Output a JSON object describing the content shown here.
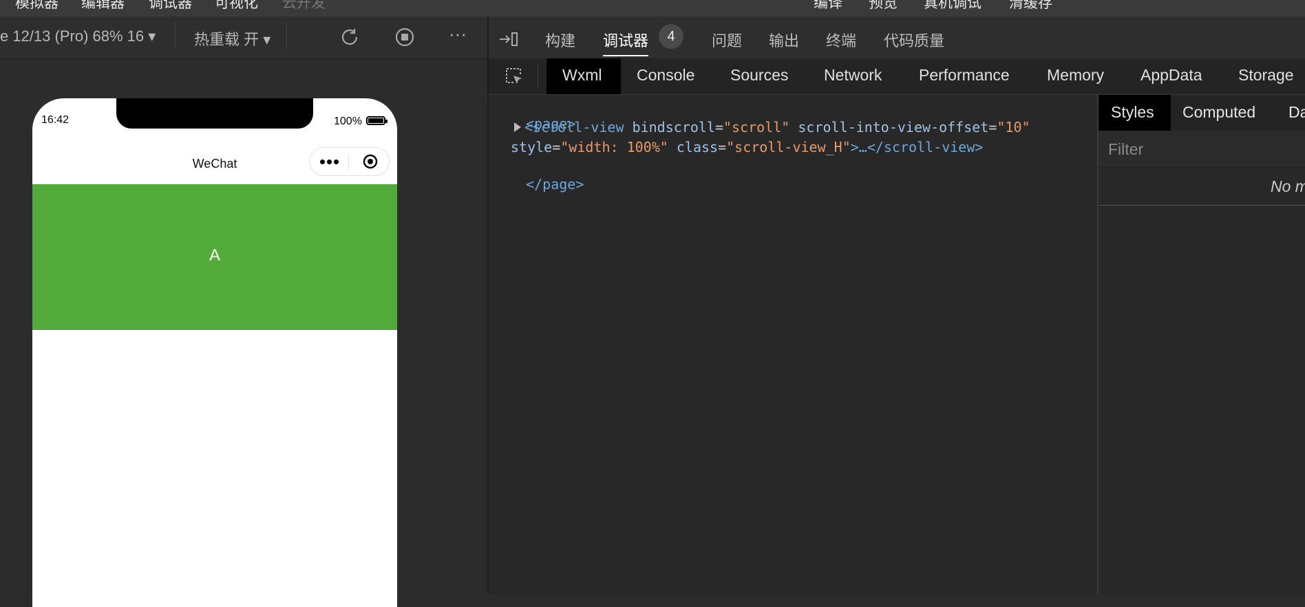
{
  "menubar": {
    "items": [
      "模拟器",
      "编辑器",
      "调试器",
      "可视化",
      "云开发"
    ],
    "right_items": [
      "编译",
      "预览",
      "真机调试",
      "清缓存"
    ]
  },
  "sim_toolbar": {
    "device": "e 12/13 (Pro) 68% 16",
    "hot_reload": "热重载 开",
    "more": "···"
  },
  "phone": {
    "time": "16:42",
    "battery": "100%",
    "nav_title": "WeChat",
    "block_label": "A",
    "block_color": "#52aa3a"
  },
  "devtools": {
    "tabs": [
      "构建",
      "调试器",
      "问题",
      "输出",
      "终端",
      "代码质量"
    ],
    "active_tab": "调试器",
    "badge": "4",
    "panel_tabs": [
      "Wxml",
      "Console",
      "Sources",
      "Network",
      "Performance",
      "Memory",
      "AppData",
      "Storage"
    ],
    "active_panel": "Wxml"
  },
  "code": {
    "line1": "<page>",
    "line2": {
      "open": "<scroll-view",
      "attr1": "bindscroll",
      "val1": "\"scroll\"",
      "attr2": "scroll-into-view-offset",
      "val2": "\"10\""
    },
    "line3": {
      "attr3": "style",
      "val3": "\"width: 100%\"",
      "attr4": "class",
      "val4": "\"scroll-view_H\"",
      "rest": ">…</scroll-view>"
    },
    "line4": "</page>"
  },
  "styles": {
    "tabs": [
      "Styles",
      "Computed",
      "Da"
    ],
    "filter_placeholder": "Filter",
    "no_match": "No m"
  }
}
